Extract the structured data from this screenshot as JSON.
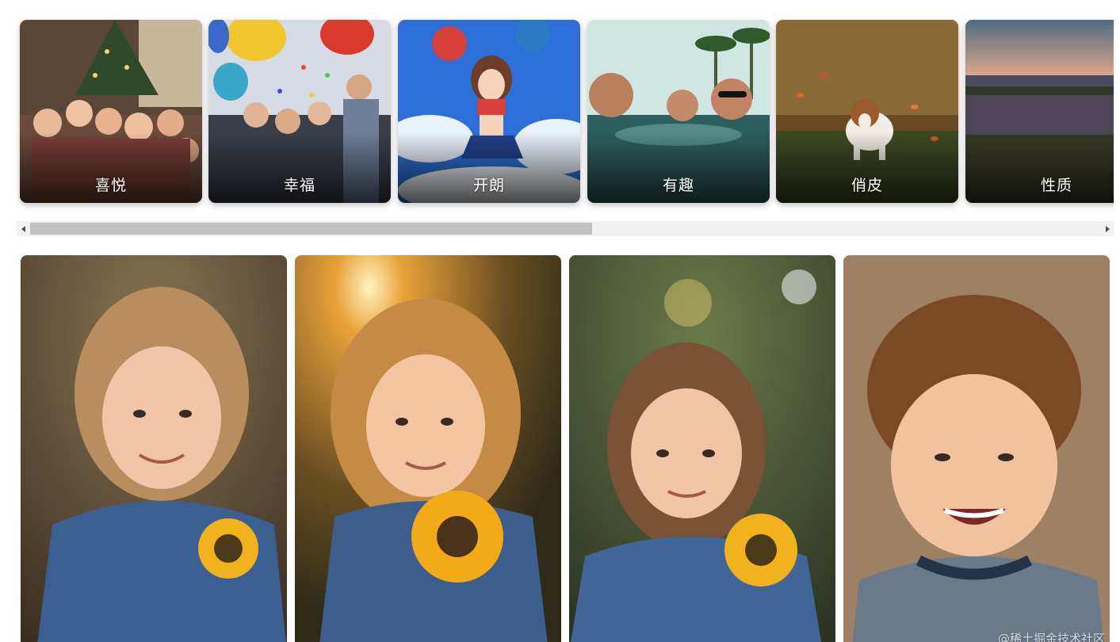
{
  "categories": [
    {
      "label": "喜悦",
      "icon": "christmas-kids-photo"
    },
    {
      "label": "幸福",
      "icon": "party-confetti-photo"
    },
    {
      "label": "开朗",
      "icon": "anime-cheerleader-image"
    },
    {
      "label": "有趣",
      "icon": "pool-splash-photo"
    },
    {
      "label": "俏皮",
      "icon": "beagle-autumn-leaves-photo"
    },
    {
      "label": "性质",
      "icon": "sunset-meadow-glitch-image"
    }
  ],
  "scrollbar": {
    "left_arrow": "scroll-left-arrow-icon",
    "right_arrow": "scroll-right-arrow-icon",
    "position_fraction": 0.0,
    "visible_fraction": 0.52
  },
  "gallery": [
    {
      "subject": "girl-denim-jacket-sunflower-smiling"
    },
    {
      "subject": "girl-backlit-sun-holding-sunflower"
    },
    {
      "subject": "girl-ponytail-denim-sunflower"
    },
    {
      "subject": "boy-curly-hair-laughing"
    }
  ],
  "watermark": "@稀土掘金技术社区",
  "colors": {
    "scroll_track": "#f1f1f1",
    "scroll_thumb": "#c1c1c1",
    "label_text": "#ffffff"
  }
}
